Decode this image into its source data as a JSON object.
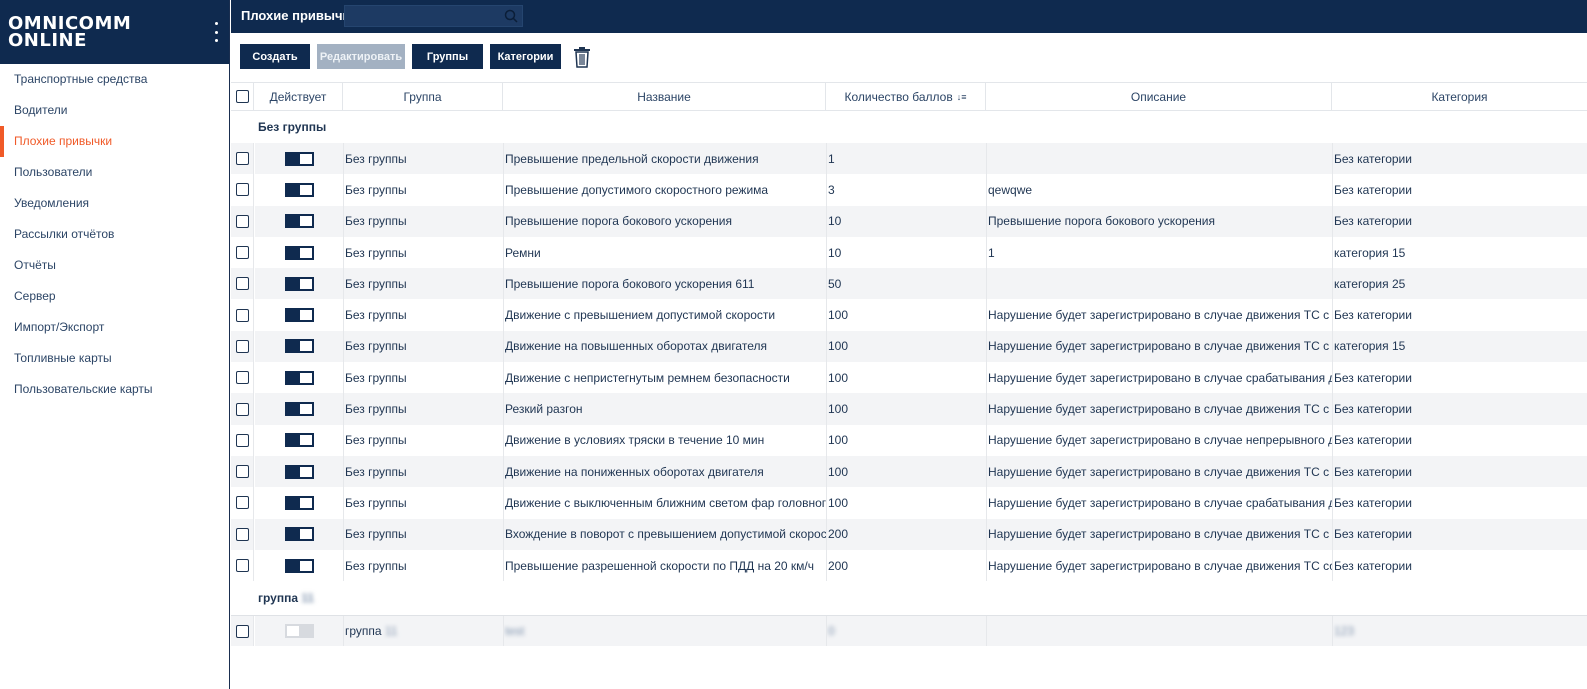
{
  "app": {
    "logo_line1": "OMNICOMM",
    "logo_line2": "ONLINE",
    "page_title": "Плохие привычки",
    "search_placeholder": ""
  },
  "sidebar": {
    "items": [
      {
        "label": "Транспортные средства",
        "active": false
      },
      {
        "label": "Водители",
        "active": false
      },
      {
        "label": "Плохие привычки",
        "active": true
      },
      {
        "label": "Пользователи",
        "active": false
      },
      {
        "label": "Уведомления",
        "active": false
      },
      {
        "label": "Рассылки отчётов",
        "active": false
      },
      {
        "label": "Отчёты",
        "active": false
      },
      {
        "label": "Сервер",
        "active": false
      },
      {
        "label": "Импорт/Экспорт",
        "active": false
      },
      {
        "label": "Топливные карты",
        "active": false
      },
      {
        "label": "Пользовательские карты",
        "active": false
      }
    ]
  },
  "toolbar": {
    "create": "Создать",
    "edit": "Редактировать",
    "groups": "Группы",
    "categories": "Категории"
  },
  "table": {
    "headers": {
      "active": "Действует",
      "group": "Группа",
      "name": "Название",
      "points": "Количество баллов",
      "description": "Описание",
      "category": "Категория"
    },
    "group1_title": "Без группы",
    "rows": [
      {
        "group": "Без группы",
        "name": "Превышение предельной скорости движения",
        "points": "1",
        "description": "",
        "category": "Без категории"
      },
      {
        "group": "Без группы",
        "name": "Превышение допустимого скоростного режима",
        "points": "3",
        "description": "qewqwe",
        "category": "Без категории"
      },
      {
        "group": "Без группы",
        "name": "Превышение порога бокового ускорения",
        "points": "10",
        "description": "Превышение порога бокового ускорения",
        "category": "Без категории"
      },
      {
        "group": "Без группы",
        "name": "Ремни",
        "points": "10",
        "description": "1",
        "category": "категория 15"
      },
      {
        "group": "Без группы",
        "name": "Превышение порога бокового ускорения 611",
        "points": "50",
        "description": "",
        "category": "категория 25"
      },
      {
        "group": "Без группы",
        "name": "Движение с превышением допустимой скорости",
        "points": "100",
        "description": "Нарушение будет зарегистрировано в случае движения ТС с превышен",
        "category": "Без категории"
      },
      {
        "group": "Без группы",
        "name": "Движение на повышенных оборотах двигателя",
        "points": "100",
        "description": "Нарушение будет зарегистрировано в случае движения ТС с оборотами",
        "category": "категория 15"
      },
      {
        "group": "Без группы",
        "name": "Движение с непристегнутым ремнем безопасности",
        "points": "100",
        "description": "Нарушение будет зарегистрировано в случае срабатывания датчика ре",
        "category": "Без категории"
      },
      {
        "group": "Без группы",
        "name": "Резкий разгон",
        "points": "100",
        "description": "Нарушение будет зарегистрировано в случае движения ТС с превышен",
        "category": "Без категории"
      },
      {
        "group": "Без группы",
        "name": "Движение в условиях тряски в течение 10 мин",
        "points": "100",
        "description": "Нарушение будет зарегистрировано в случае непрерывного движения",
        "category": "Без категории"
      },
      {
        "group": "Без группы",
        "name": "Движение на пониженных оборотах двигателя",
        "points": "100",
        "description": "Нарушение будет зарегистрировано в случае движения ТС с оборотами",
        "category": "Без категории"
      },
      {
        "group": "Без группы",
        "name": "Движение с выключенным ближним светом фар головного света",
        "points": "100",
        "description": "Нарушение будет зарегистрировано в случае срабатывания датчика фа",
        "category": "Без категории"
      },
      {
        "group": "Без группы",
        "name": "Вхождение в поворот с превышением допустимой скорости",
        "points": "200",
        "description": "Нарушение будет зарегистрировано в случае движения ТС с превышен",
        "category": "Без категории"
      },
      {
        "group": "Без группы",
        "name": "Превышение разрешенной скорости по ПДД на 20 км/ч",
        "points": "200",
        "description": "Нарушение будет зарегистрировано в случае движения ТС со скорость",
        "category": "Без категории"
      }
    ],
    "group2_title": "группа",
    "group2_title_suffix": "11",
    "row_last": {
      "group": "группа",
      "group_suffix": "11",
      "name": "test",
      "points": "0",
      "description": "",
      "category": "123"
    }
  },
  "colors": {
    "navy": "#0f2a4f",
    "accent": "#f05a28",
    "disabled": "#a3b1c2"
  },
  "icons": [
    "kebab-menu-icon",
    "search-icon",
    "trash-icon",
    "sort-icon"
  ]
}
